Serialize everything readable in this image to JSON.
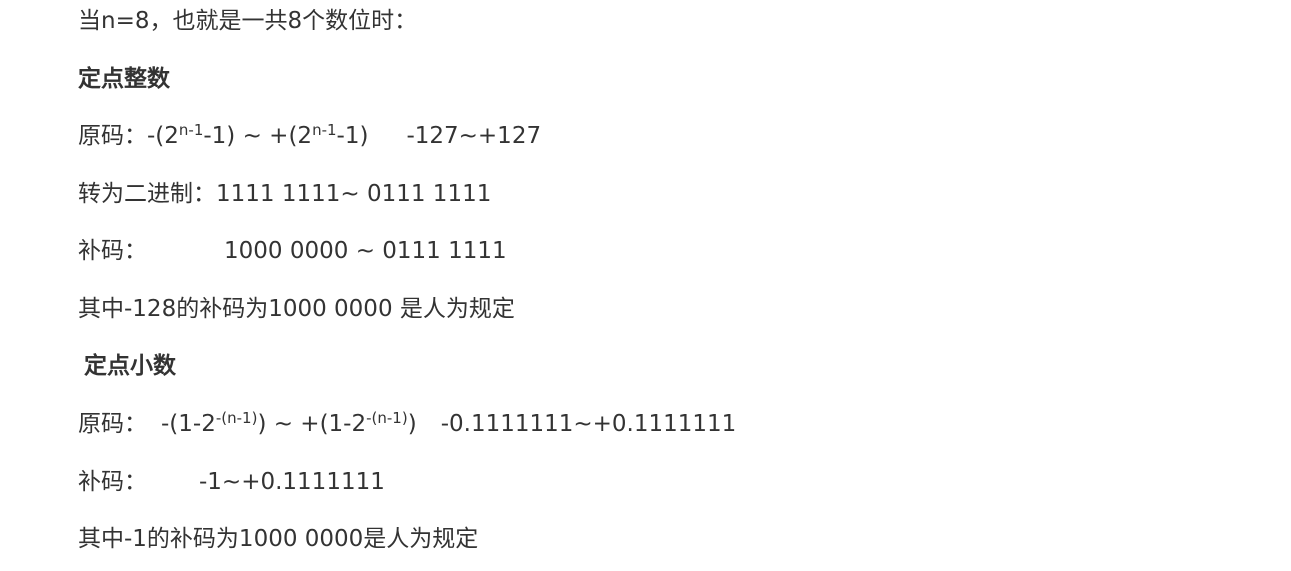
{
  "doc": {
    "intro": "当n=8，也就是一共8个数位时：",
    "int_heading": "定点整数",
    "int_orig_label": "原码：",
    "int_orig_pre": "-(2",
    "int_orig_sup1": "n-1",
    "int_orig_mid": "-1) ~ +(2",
    "int_orig_sup2": "n-1",
    "int_orig_end": "-1)",
    "int_orig_range": "-127~+127",
    "binary_line": "转为二进制：1111 1111~ 0111 1111",
    "int_comp_label": "补码：",
    "int_comp_value": "1000 0000 ~ 0111 1111",
    "int_note": "其中-128的补码为1000 0000 是人为规定",
    "frac_heading": "定点小数",
    "frac_orig_label": "原码：",
    "frac_orig_pre": "-(1-2",
    "frac_orig_sup1": "-(n-1)",
    "frac_orig_mid": ") ~ +(1-2",
    "frac_orig_sup2": "-(n-1)",
    "frac_orig_end": ")",
    "frac_orig_range": "-0.1111111~+0.1111111",
    "frac_comp_label": "补码：",
    "frac_comp_value": "-1~+0.1111111",
    "frac_note": "其中-1的补码为1000 0000是人为规定"
  },
  "colors": {
    "text": "#333333",
    "background": "#ffffff"
  }
}
